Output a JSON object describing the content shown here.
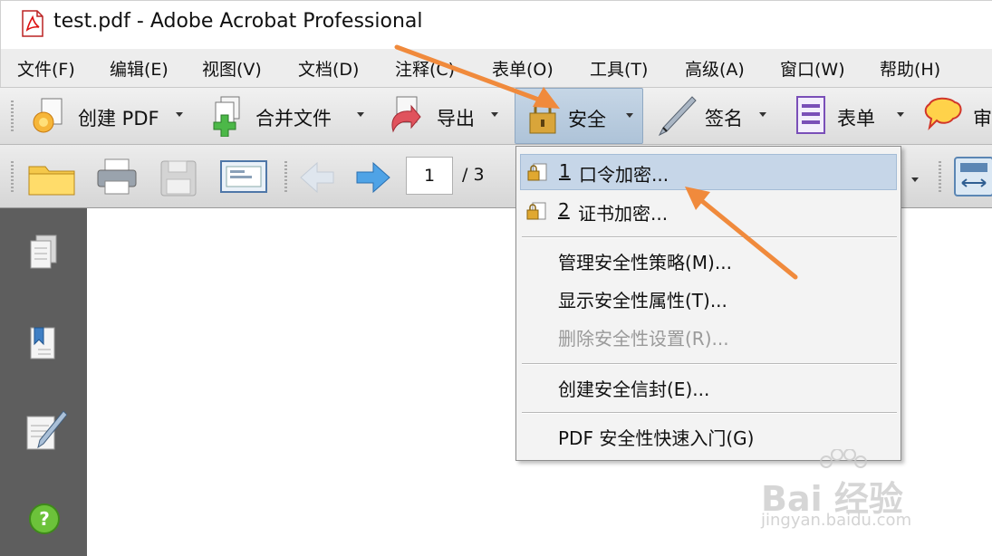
{
  "window": {
    "title": "test.pdf - Adobe Acrobat Professional",
    "icon": "pdf-file-icon"
  },
  "menubar": {
    "items": [
      "文件(F)",
      "编辑(E)",
      "视图(V)",
      "文档(D)",
      "注释(C)",
      "表单(O)",
      "工具(T)",
      "高级(A)",
      "窗口(W)",
      "帮助(H)"
    ]
  },
  "toolbar": {
    "create_pdf": "创建 PDF",
    "combine": "合并文件",
    "export": "导出",
    "security": "安全",
    "sign": "签名",
    "forms": "表单",
    "review": "审"
  },
  "navigation": {
    "page_current": "1",
    "page_total": "/ 3"
  },
  "security_menu": {
    "items": [
      {
        "key": "1",
        "label": "口令加密...",
        "highlighted": true
      },
      {
        "key": "2",
        "label": "证书加密..."
      },
      {
        "label": "管理安全性策略(M)..."
      },
      {
        "label": "显示安全性属性(T)..."
      },
      {
        "label": "删除安全性设置(R)...",
        "disabled": true
      },
      {
        "label": "创建安全信封(E)..."
      },
      {
        "label": "PDF 安全性快速入门(G)"
      }
    ]
  },
  "watermark": {
    "brand": "Bai 经验",
    "url": "jingyan.baidu.com"
  },
  "colors": {
    "accent_arrow": "#f08a3c",
    "highlight": "#c6d6e8",
    "nav_panel": "#5e5e5e"
  }
}
